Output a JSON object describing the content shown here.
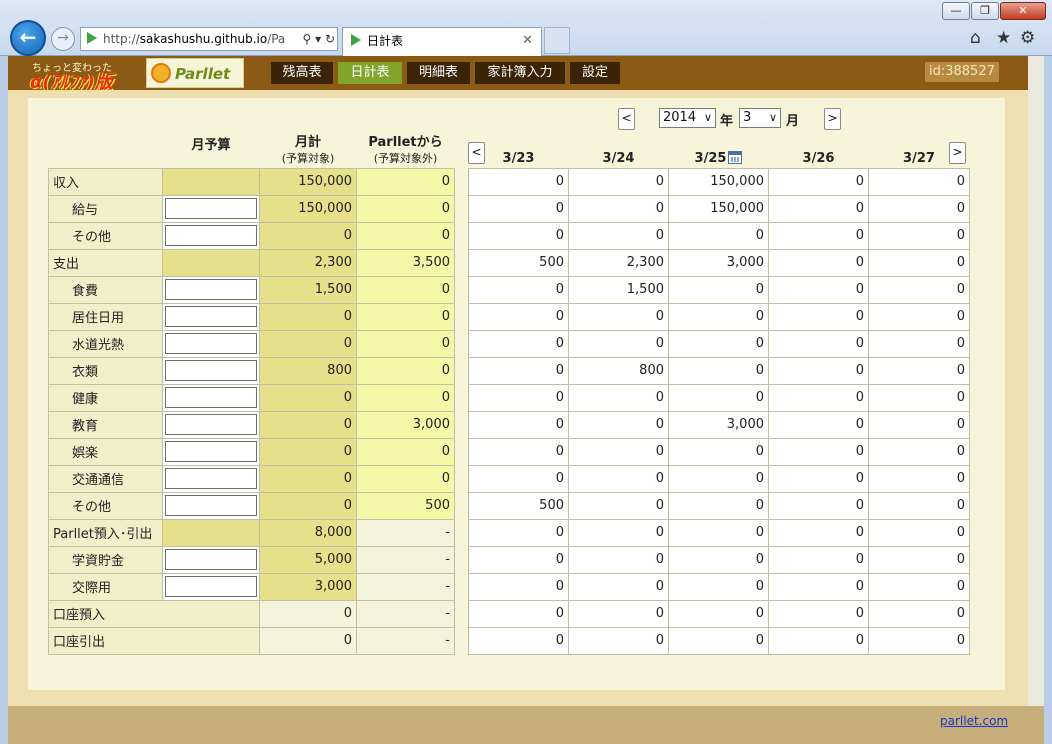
{
  "browser": {
    "url_prefix": "http://",
    "url_host": "sakashushu.github.io",
    "url_rest": "/Pa",
    "tab_title": "日計表",
    "min_glyph": "—",
    "max_glyph": "❐",
    "close_glyph": "✕",
    "back_glyph": "←",
    "forward_glyph": "→",
    "address_icons": "⚲ ▾ ↻",
    "tab_close_glyph": "✕",
    "home_glyph": "⌂",
    "star_glyph": "★",
    "gear_glyph": "⚙"
  },
  "app": {
    "logo_sub": "ちょっと変わった",
    "logo_main": "α(ｱﾙﾌｧ)版",
    "logo_product": "Parllet",
    "nav": [
      "残高表",
      "日計表",
      "明細表",
      "家計簿入力",
      "設定"
    ],
    "active_nav": 1,
    "user_id": "id:388527",
    "footer_link": "parllet.com"
  },
  "period": {
    "prev_month": "<",
    "next_month": ">",
    "year": "2014",
    "year_label": "年",
    "month": "3",
    "month_label": "月",
    "dropdown_glyph": "∨"
  },
  "left_header": {
    "budget": "月予算",
    "monthly": "月計",
    "monthly_sub": "(予算対象)",
    "parllet": "Parlletから",
    "parllet_sub": "(予算対象外)"
  },
  "days": {
    "prev": "<",
    "next": ">",
    "columns": [
      "3/23",
      "3/24",
      "3/25",
      "3/26",
      "3/27"
    ]
  },
  "rows": [
    {
      "label": "収入",
      "indent": false,
      "budget": "group",
      "monthly": "150,000",
      "parllet": "0",
      "days": [
        "0",
        "0",
        "150,000",
        "0",
        "0"
      ]
    },
    {
      "label": "給与",
      "indent": true,
      "budget": "input",
      "monthly": "150,000",
      "parllet": "0",
      "days": [
        "0",
        "0",
        "150,000",
        "0",
        "0"
      ]
    },
    {
      "label": "その他",
      "indent": true,
      "budget": "input",
      "monthly": "0",
      "parllet": "0",
      "days": [
        "0",
        "0",
        "0",
        "0",
        "0"
      ]
    },
    {
      "label": "支出",
      "indent": false,
      "budget": "group",
      "monthly": "2,300",
      "parllet": "3,500",
      "days": [
        "500",
        "2,300",
        "3,000",
        "0",
        "0"
      ]
    },
    {
      "label": "食費",
      "indent": true,
      "budget": "input",
      "monthly": "1,500",
      "parllet": "0",
      "days": [
        "0",
        "1,500",
        "0",
        "0",
        "0"
      ]
    },
    {
      "label": "居住日用",
      "indent": true,
      "budget": "input",
      "monthly": "0",
      "parllet": "0",
      "days": [
        "0",
        "0",
        "0",
        "0",
        "0"
      ]
    },
    {
      "label": "水道光熱",
      "indent": true,
      "budget": "input",
      "monthly": "0",
      "parllet": "0",
      "days": [
        "0",
        "0",
        "0",
        "0",
        "0"
      ]
    },
    {
      "label": "衣類",
      "indent": true,
      "budget": "input",
      "monthly": "800",
      "parllet": "0",
      "days": [
        "0",
        "800",
        "0",
        "0",
        "0"
      ]
    },
    {
      "label": "健康",
      "indent": true,
      "budget": "input",
      "monthly": "0",
      "parllet": "0",
      "days": [
        "0",
        "0",
        "0",
        "0",
        "0"
      ]
    },
    {
      "label": "教育",
      "indent": true,
      "budget": "input",
      "monthly": "0",
      "parllet": "3,000",
      "days": [
        "0",
        "0",
        "3,000",
        "0",
        "0"
      ]
    },
    {
      "label": "娯楽",
      "indent": true,
      "budget": "input",
      "monthly": "0",
      "parllet": "0",
      "days": [
        "0",
        "0",
        "0",
        "0",
        "0"
      ]
    },
    {
      "label": "交通通信",
      "indent": true,
      "budget": "input",
      "monthly": "0",
      "parllet": "0",
      "days": [
        "0",
        "0",
        "0",
        "0",
        "0"
      ]
    },
    {
      "label": "その他",
      "indent": true,
      "budget": "input",
      "monthly": "0",
      "parllet": "500",
      "days": [
        "500",
        "0",
        "0",
        "0",
        "0"
      ]
    },
    {
      "label": "Parllet預入･引出",
      "indent": false,
      "budget": "group",
      "monthly": "8,000",
      "parllet": "-",
      "days": [
        "0",
        "0",
        "0",
        "0",
        "0"
      ]
    },
    {
      "label": "学資貯金",
      "indent": true,
      "budget": "input",
      "monthly": "5,000",
      "parllet": "-",
      "days": [
        "0",
        "0",
        "0",
        "0",
        "0"
      ]
    },
    {
      "label": "交際用",
      "indent": true,
      "budget": "input",
      "monthly": "3,000",
      "parllet": "-",
      "days": [
        "0",
        "0",
        "0",
        "0",
        "0"
      ]
    },
    {
      "label": "口座預入",
      "indent": false,
      "budget": "span",
      "monthly": "0",
      "parllet": "-",
      "days": [
        "0",
        "0",
        "0",
        "0",
        "0"
      ]
    },
    {
      "label": "口座引出",
      "indent": false,
      "budget": "span",
      "monthly": "0",
      "parllet": "-",
      "days": [
        "0",
        "0",
        "0",
        "0",
        "0"
      ]
    }
  ]
}
